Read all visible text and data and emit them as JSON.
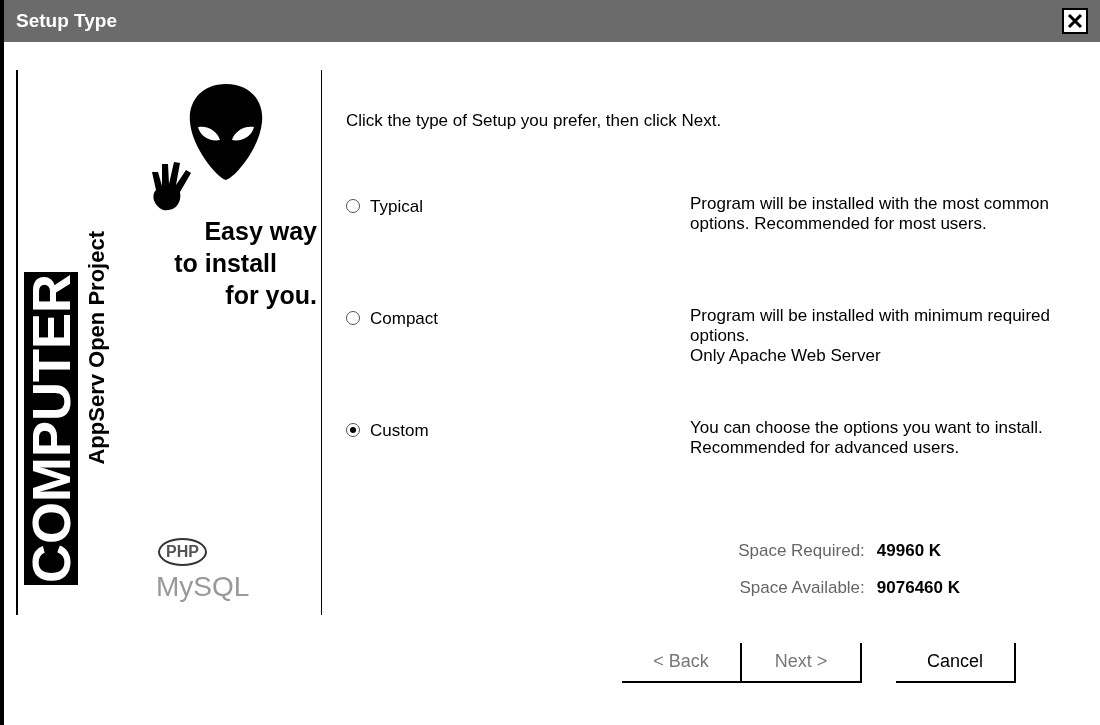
{
  "window": {
    "title": "Setup Type"
  },
  "banner": {
    "brand": "COMPUTER",
    "subtitle": "AppServ Open Project",
    "slogan": [
      "Easy way",
      "to install",
      "for you."
    ],
    "php_logo": "PHP",
    "mysql_logo": "MySQL"
  },
  "instruction": "Click the type of Setup you prefer, then click Next.",
  "options": [
    {
      "label": "Typical",
      "description": "Program will be installed with the most common\noptions. Recommended for most users.",
      "selected": false
    },
    {
      "label": "Compact",
      "description": "Program will be installed with minimum required\noptions.\nOnly Apache Web Server",
      "selected": false
    },
    {
      "label": "Custom",
      "description": "You can choose the options you want to install.\nRecommended for advanced users.",
      "selected": true
    }
  ],
  "space": [
    {
      "label": "Space Required:",
      "value": "49960 K"
    },
    {
      "label": "Space Available:",
      "value": "9076460 K"
    }
  ],
  "buttons": [
    {
      "label": "< Back",
      "disabled": true
    },
    {
      "label": "Next >",
      "disabled": true
    },
    {
      "label": "Cancel",
      "disabled": false
    }
  ]
}
